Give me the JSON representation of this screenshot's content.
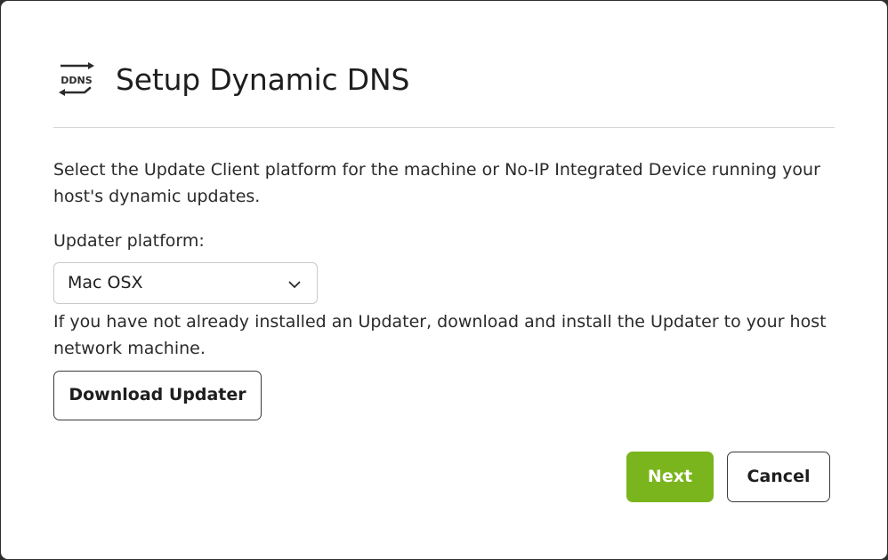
{
  "dialog": {
    "icon_label": "DDNS",
    "icon_name": "ddns-icon",
    "title": "Setup Dynamic DNS",
    "description": "Select the Update Client platform for the machine or No-IP Integrated Device running your host's dynamic updates.",
    "platform_label": "Updater platform:",
    "platform_select": {
      "selected": "Mac OSX",
      "icon": "chevron-down-icon"
    },
    "install_text": "If you have not already installed an Updater, download and install the Updater to your host network machine.",
    "download_button": "Download Updater",
    "next_button": "Next",
    "cancel_button": "Cancel"
  },
  "colors": {
    "accent": "#7ab51d",
    "text": "#2a2a2a",
    "divider": "#d6d6d6"
  }
}
